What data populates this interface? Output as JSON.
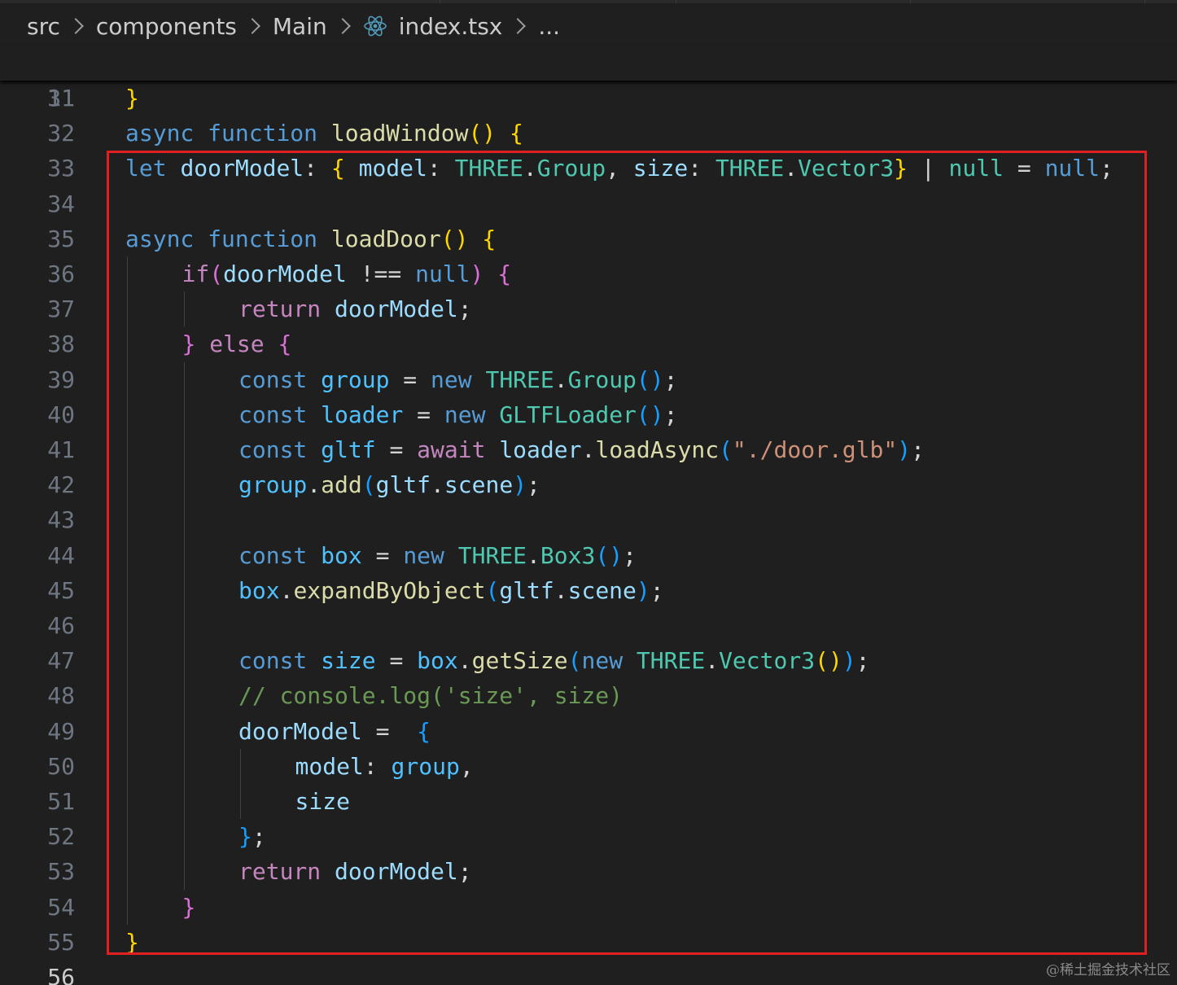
{
  "breadcrumb": {
    "items": [
      "src",
      "components",
      "Main",
      "index.tsx",
      "..."
    ],
    "file_icon": "react-icon"
  },
  "watermark": "@稀土掘金技术社区",
  "colors": {
    "background": "#1f1f1f",
    "line_number": "#6e7681",
    "highlight_frame": "#e02020",
    "keyword": "#569cd6",
    "control": "#c586c0",
    "function": "#dcdcaa",
    "variable": "#9cdcfe",
    "type": "#4ec9b0",
    "string": "#ce9178",
    "comment": "#6a9955",
    "bracket_level1": "#ffd700",
    "bracket_level2": "#da70d6",
    "bracket_level3": "#179fff"
  },
  "editor": {
    "sticky_line": {
      "number": "11",
      "tokens": [
        [
          "k",
          "async"
        ],
        [
          "p",
          " "
        ],
        [
          "k",
          "function"
        ],
        [
          "p",
          " "
        ],
        [
          "f",
          "loadWindow"
        ],
        [
          "b1",
          "()"
        ],
        [
          "p",
          " "
        ],
        [
          "b1",
          "{"
        ]
      ]
    },
    "lines": [
      {
        "number": "31",
        "indent": 0,
        "tokens": [
          [
            "b1",
            "}"
          ]
        ]
      },
      {
        "number": "32",
        "indent": 0,
        "tokens": []
      },
      {
        "number": "33",
        "indent": 0,
        "tokens": [
          [
            "k",
            "let"
          ],
          [
            "p",
            " "
          ],
          [
            "v",
            "doorModel"
          ],
          [
            "p",
            ": "
          ],
          [
            "b1",
            "{"
          ],
          [
            "p",
            " "
          ],
          [
            "v",
            "model"
          ],
          [
            "p",
            ": "
          ],
          [
            "t",
            "THREE"
          ],
          [
            "p",
            "."
          ],
          [
            "t",
            "Group"
          ],
          [
            "p",
            ", "
          ],
          [
            "v",
            "size"
          ],
          [
            "p",
            ": "
          ],
          [
            "t",
            "THREE"
          ],
          [
            "p",
            "."
          ],
          [
            "t",
            "Vector3"
          ],
          [
            "b1",
            "}"
          ],
          [
            "p",
            " | "
          ],
          [
            "t",
            "null"
          ],
          [
            "p",
            " = "
          ],
          [
            "k",
            "null"
          ],
          [
            "p",
            ";"
          ]
        ]
      },
      {
        "number": "34",
        "indent": 0,
        "tokens": []
      },
      {
        "number": "35",
        "indent": 0,
        "tokens": [
          [
            "k",
            "async"
          ],
          [
            "p",
            " "
          ],
          [
            "k",
            "function"
          ],
          [
            "p",
            " "
          ],
          [
            "f",
            "loadDoor"
          ],
          [
            "b1",
            "()"
          ],
          [
            "p",
            " "
          ],
          [
            "b1",
            "{"
          ]
        ]
      },
      {
        "number": "36",
        "indent": 1,
        "tokens": [
          [
            "c",
            "if"
          ],
          [
            "b2",
            "("
          ],
          [
            "v",
            "doorModel"
          ],
          [
            "p",
            " !== "
          ],
          [
            "k",
            "null"
          ],
          [
            "b2",
            ")"
          ],
          [
            "p",
            " "
          ],
          [
            "b2",
            "{"
          ]
        ]
      },
      {
        "number": "37",
        "indent": 2,
        "tokens": [
          [
            "c",
            "return"
          ],
          [
            "p",
            " "
          ],
          [
            "v",
            "doorModel"
          ],
          [
            "p",
            ";"
          ]
        ]
      },
      {
        "number": "38",
        "indent": 1,
        "tokens": [
          [
            "b2",
            "}"
          ],
          [
            "p",
            " "
          ],
          [
            "c",
            "else"
          ],
          [
            "p",
            " "
          ],
          [
            "b2",
            "{"
          ]
        ]
      },
      {
        "number": "39",
        "indent": 2,
        "tokens": [
          [
            "k",
            "const"
          ],
          [
            "p",
            " "
          ],
          [
            "cv",
            "group"
          ],
          [
            "p",
            " = "
          ],
          [
            "k",
            "new"
          ],
          [
            "p",
            " "
          ],
          [
            "t",
            "THREE"
          ],
          [
            "p",
            "."
          ],
          [
            "t",
            "Group"
          ],
          [
            "b3",
            "()"
          ],
          [
            "p",
            ";"
          ]
        ]
      },
      {
        "number": "40",
        "indent": 2,
        "tokens": [
          [
            "k",
            "const"
          ],
          [
            "p",
            " "
          ],
          [
            "cv",
            "loader"
          ],
          [
            "p",
            " = "
          ],
          [
            "k",
            "new"
          ],
          [
            "p",
            " "
          ],
          [
            "t",
            "GLTFLoader"
          ],
          [
            "b3",
            "()"
          ],
          [
            "p",
            ";"
          ]
        ]
      },
      {
        "number": "41",
        "indent": 2,
        "tokens": [
          [
            "k",
            "const"
          ],
          [
            "p",
            " "
          ],
          [
            "cv",
            "gltf"
          ],
          [
            "p",
            " = "
          ],
          [
            "c",
            "await"
          ],
          [
            "p",
            " "
          ],
          [
            "v",
            "loader"
          ],
          [
            "p",
            "."
          ],
          [
            "f",
            "loadAsync"
          ],
          [
            "b3",
            "("
          ],
          [
            "s",
            "\"./door.glb\""
          ],
          [
            "b3",
            ")"
          ],
          [
            "p",
            ";"
          ]
        ]
      },
      {
        "number": "42",
        "indent": 2,
        "tokens": [
          [
            "cv",
            "group"
          ],
          [
            "p",
            "."
          ],
          [
            "f",
            "add"
          ],
          [
            "b3",
            "("
          ],
          [
            "v",
            "gltf"
          ],
          [
            "p",
            "."
          ],
          [
            "v",
            "scene"
          ],
          [
            "b3",
            ")"
          ],
          [
            "p",
            ";"
          ]
        ]
      },
      {
        "number": "43",
        "indent": 2,
        "tokens": []
      },
      {
        "number": "44",
        "indent": 2,
        "tokens": [
          [
            "k",
            "const"
          ],
          [
            "p",
            " "
          ],
          [
            "cv",
            "box"
          ],
          [
            "p",
            " = "
          ],
          [
            "k",
            "new"
          ],
          [
            "p",
            " "
          ],
          [
            "t",
            "THREE"
          ],
          [
            "p",
            "."
          ],
          [
            "t",
            "Box3"
          ],
          [
            "b3",
            "()"
          ],
          [
            "p",
            ";"
          ]
        ]
      },
      {
        "number": "45",
        "indent": 2,
        "tokens": [
          [
            "cv",
            "box"
          ],
          [
            "p",
            "."
          ],
          [
            "f",
            "expandByObject"
          ],
          [
            "b3",
            "("
          ],
          [
            "v",
            "gltf"
          ],
          [
            "p",
            "."
          ],
          [
            "v",
            "scene"
          ],
          [
            "b3",
            ")"
          ],
          [
            "p",
            ";"
          ]
        ]
      },
      {
        "number": "46",
        "indent": 2,
        "tokens": []
      },
      {
        "number": "47",
        "indent": 2,
        "tokens": [
          [
            "k",
            "const"
          ],
          [
            "p",
            " "
          ],
          [
            "cv",
            "size"
          ],
          [
            "p",
            " = "
          ],
          [
            "cv",
            "box"
          ],
          [
            "p",
            "."
          ],
          [
            "f",
            "getSize"
          ],
          [
            "b3",
            "("
          ],
          [
            "k",
            "new"
          ],
          [
            "p",
            " "
          ],
          [
            "t",
            "THREE"
          ],
          [
            "p",
            "."
          ],
          [
            "t",
            "Vector3"
          ],
          [
            "b1",
            "()"
          ],
          [
            "b3",
            ")"
          ],
          [
            "p",
            ";"
          ]
        ]
      },
      {
        "number": "48",
        "indent": 2,
        "tokens": [
          [
            "cm",
            "// console.log('size', size)"
          ]
        ]
      },
      {
        "number": "49",
        "indent": 2,
        "tokens": [
          [
            "v",
            "doorModel"
          ],
          [
            "p",
            " =  "
          ],
          [
            "b3",
            "{"
          ]
        ]
      },
      {
        "number": "50",
        "indent": 3,
        "tokens": [
          [
            "v",
            "model"
          ],
          [
            "p",
            ": "
          ],
          [
            "cv",
            "group"
          ],
          [
            "p",
            ","
          ]
        ]
      },
      {
        "number": "51",
        "indent": 3,
        "tokens": [
          [
            "v",
            "size"
          ]
        ]
      },
      {
        "number": "52",
        "indent": 2,
        "tokens": [
          [
            "b3",
            "}"
          ],
          [
            "p",
            ";"
          ]
        ]
      },
      {
        "number": "53",
        "indent": 2,
        "tokens": [
          [
            "c",
            "return"
          ],
          [
            "p",
            " "
          ],
          [
            "v",
            "doorModel"
          ],
          [
            "p",
            ";"
          ]
        ]
      },
      {
        "number": "54",
        "indent": 1,
        "tokens": [
          [
            "b2",
            "}"
          ]
        ]
      },
      {
        "number": "55",
        "indent": 0,
        "tokens": [
          [
            "b1",
            "}"
          ]
        ]
      },
      {
        "number": "56",
        "indent": 0,
        "tokens": []
      }
    ]
  }
}
